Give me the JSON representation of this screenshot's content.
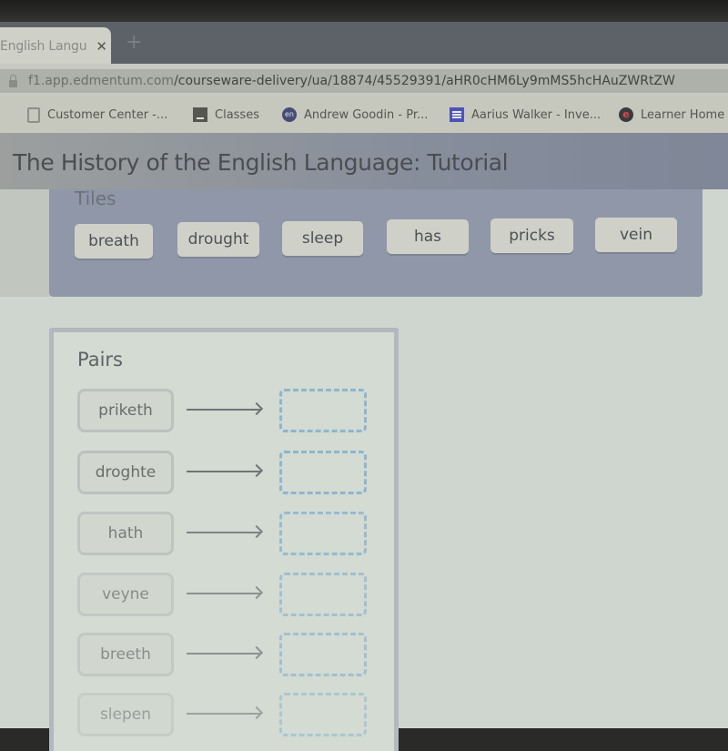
{
  "browser": {
    "tab_title": "English Langu",
    "tab_close": "✕",
    "new_tab": "+",
    "url_host": "f1.app.edmentum.com",
    "url_path": "/courseware-delivery/ua/18874/45529391/aHR0cHM6Ly9mMS5hcHAuZWRtZW",
    "bookmarks": [
      {
        "label": "Customer Center -...",
        "icon": "document-icon"
      },
      {
        "label": "Classes",
        "icon": "classroom-icon"
      },
      {
        "label": "Andrew Goodin - Pr...",
        "icon": "circle-logo-icon",
        "icon_text": "en"
      },
      {
        "label": "Aarius Walker - Inve...",
        "icon": "form-icon"
      },
      {
        "label": "Learner Home",
        "icon": "edmentum-icon",
        "icon_text": "e"
      }
    ]
  },
  "page": {
    "title": "The History of the English Language: Tutorial",
    "tiles_label": "Tiles",
    "tiles": [
      "breath",
      "drought",
      "sleep",
      "has",
      "pricks",
      "vein"
    ],
    "pairs_label": "Pairs",
    "pairs": [
      {
        "source": "priketh",
        "target": ""
      },
      {
        "source": "droghte",
        "target": ""
      },
      {
        "source": "hath",
        "target": ""
      },
      {
        "source": "veyne",
        "target": ""
      },
      {
        "source": "breeth",
        "target": ""
      },
      {
        "source": "slepen",
        "target": ""
      }
    ]
  },
  "colors": {
    "target_border": "#8eb5cf",
    "tiles_panel": "#8f97a8"
  }
}
